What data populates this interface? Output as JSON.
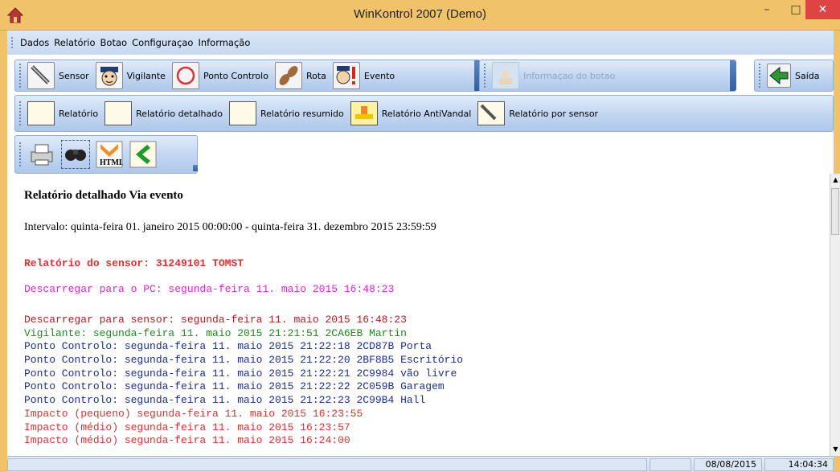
{
  "window": {
    "title": "WinKontrol 2007 (Demo)",
    "minimize_glyph": "–",
    "maximize_glyph": "□",
    "close_glyph": "✕"
  },
  "menu": {
    "items": [
      "Dados",
      "Relatório",
      "Botao",
      "Configuraçao",
      "Informação"
    ]
  },
  "toolbar_main": {
    "buttons": [
      {
        "label": "Sensor",
        "icon": "sensor-icon"
      },
      {
        "label": "Vigilante",
        "icon": "guard-icon"
      },
      {
        "label": "Ponto Controlo",
        "icon": "checkpoint-icon"
      },
      {
        "label": "Rota",
        "icon": "route-icon"
      },
      {
        "label": "Evento",
        "icon": "event-icon"
      }
    ]
  },
  "toolbar_info": {
    "label": "Informaçao do botao",
    "icon": "button-info-icon"
  },
  "toolbar_exit": {
    "label": "Saída",
    "icon": "exit-icon"
  },
  "toolbar_reports": {
    "buttons": [
      {
        "label": "Relatório",
        "icon": "report-icon"
      },
      {
        "label": "Relatório detalhado",
        "icon": "detailed-report-icon"
      },
      {
        "label": "Relatório resumido",
        "icon": "summary-report-icon"
      },
      {
        "label": "Relatório AntiVandal",
        "icon": "antivandal-report-icon"
      },
      {
        "label": "Relatório por sensor",
        "icon": "sensor-report-icon"
      }
    ]
  },
  "toolbar_tools": {
    "icons": [
      "print-icon",
      "find-icon",
      "html-export-icon",
      "back-icon"
    ]
  },
  "report": {
    "heading": "Relatório detalhado Via evento",
    "interval": "Intervalo: quinta-feira 01. janeiro 2015 00:00:00 - quinta-feira 31. dezembro 2015 23:59:59",
    "sensor_line": "Relatório do sensor: 31249101 TOMST",
    "download_pc": "Descarregar para o PC: segunda-feira 11. maio 2015 16:48:23",
    "log": [
      {
        "text": "Descarregar para sensor: segunda-feira 11. maio 2015 16:48:23",
        "color": "#b0201e"
      },
      {
        "text": "Vigilante: segunda-feira 11. maio 2015 21:21:51 2CA6EB Martin",
        "color": "#1e8a1e"
      },
      {
        "text": "Ponto Controlo: segunda-feira 11. maio 2015 21:22:18 2CD87B Porta",
        "color": "#1a2e9a"
      },
      {
        "text": "Ponto Controlo: segunda-feira 11. maio 2015 21:22:20 2BF8B5 Escritório",
        "color": "#1a2e9a"
      },
      {
        "text": "Ponto Controlo: segunda-feira 11. maio 2015 21:22:21 2C9984 vão livre",
        "color": "#1a2e9a"
      },
      {
        "text": "Ponto Controlo: segunda-feira 11. maio 2015 21:22:22 2C059B Garagem",
        "color": "#1a2e9a"
      },
      {
        "text": "Ponto Controlo: segunda-feira 11. maio 2015 21:22:23 2C99B4 Hall",
        "color": "#1a2e9a"
      },
      {
        "text": "Impacto (pequeno) segunda-feira 11. maio 2015 16:23:55",
        "color": "#e03030"
      },
      {
        "text": "Impacto (médio) segunda-feira 11. maio 2015 16:23:57",
        "color": "#e03030"
      },
      {
        "text": "Impacto (médio) segunda-feira 11. maio 2015 16:24:00",
        "color": "#e03030"
      }
    ]
  },
  "status": {
    "date": "08/08/2015",
    "time": "14:04:34"
  },
  "colors": {
    "titlebar": "#f0c36a",
    "close_button": "#e04343",
    "toolbar_blue": "#c3d7f1"
  }
}
